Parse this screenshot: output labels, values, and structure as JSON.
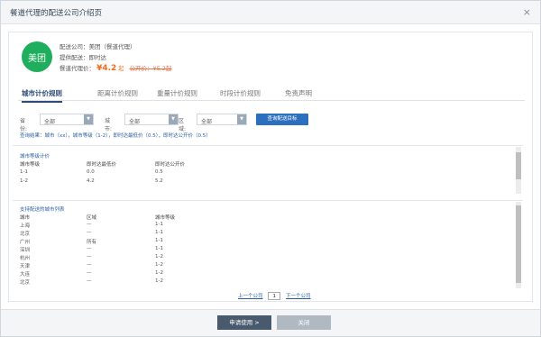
{
  "dialog": {
    "title": "餐道代理的配送公司介绍页",
    "close": "×"
  },
  "company": {
    "logo_text": "美团",
    "name_line": "配送公司：美团（餐道代理）",
    "service_line": "提供配送：即时达",
    "price_label": "餐道代理价：",
    "price": "¥4.2",
    "price_unit": "起",
    "orig_price": "公开价：¥5.2起"
  },
  "tabs": [
    {
      "label": "城市计价规则"
    },
    {
      "label": "距离计价规则"
    },
    {
      "label": "重量计价规则"
    },
    {
      "label": "时段计价规则"
    },
    {
      "label": "免责声明"
    }
  ],
  "filters": {
    "province_label": "省份:",
    "province_value": "全部",
    "city_label": "城市:",
    "city_value": "全部",
    "district_label": "区域:",
    "district_value": "全部",
    "query_button": "查询配送目标"
  },
  "result_text": "查询结果：城市（xx），城市等级（1-2），即时达最低价（0.5），即时达公开价（0.5）",
  "city_level_table": {
    "title": "城市等级计价",
    "headers": [
      "城市等级",
      "即时达最低价",
      "即时达公开价"
    ],
    "rows": [
      [
        "1-1",
        "0.0",
        "0.5"
      ],
      [
        "1-2",
        "4.2",
        "5.2"
      ]
    ]
  },
  "city_list_table": {
    "title": "支持配送的城市列表",
    "headers": [
      "城市",
      "区域",
      "城市等级"
    ],
    "rows": [
      [
        "上海",
        "—",
        "1-1"
      ],
      [
        "北京",
        "—",
        "1-1"
      ],
      [
        "广州",
        "所有",
        "1-1"
      ],
      [
        "深圳",
        "—",
        "1-1"
      ],
      [
        "杭州",
        "—",
        "1-2"
      ],
      [
        "天津",
        "—",
        "1-2"
      ],
      [
        "大连",
        "—",
        "1-2"
      ],
      [
        "北京",
        "—",
        "1-2"
      ]
    ]
  },
  "pager": {
    "prev": "上一个公司",
    "page": "1",
    "next": "下一个公司"
  },
  "footer": {
    "apply": "申请使用 >",
    "close": "关闭"
  }
}
